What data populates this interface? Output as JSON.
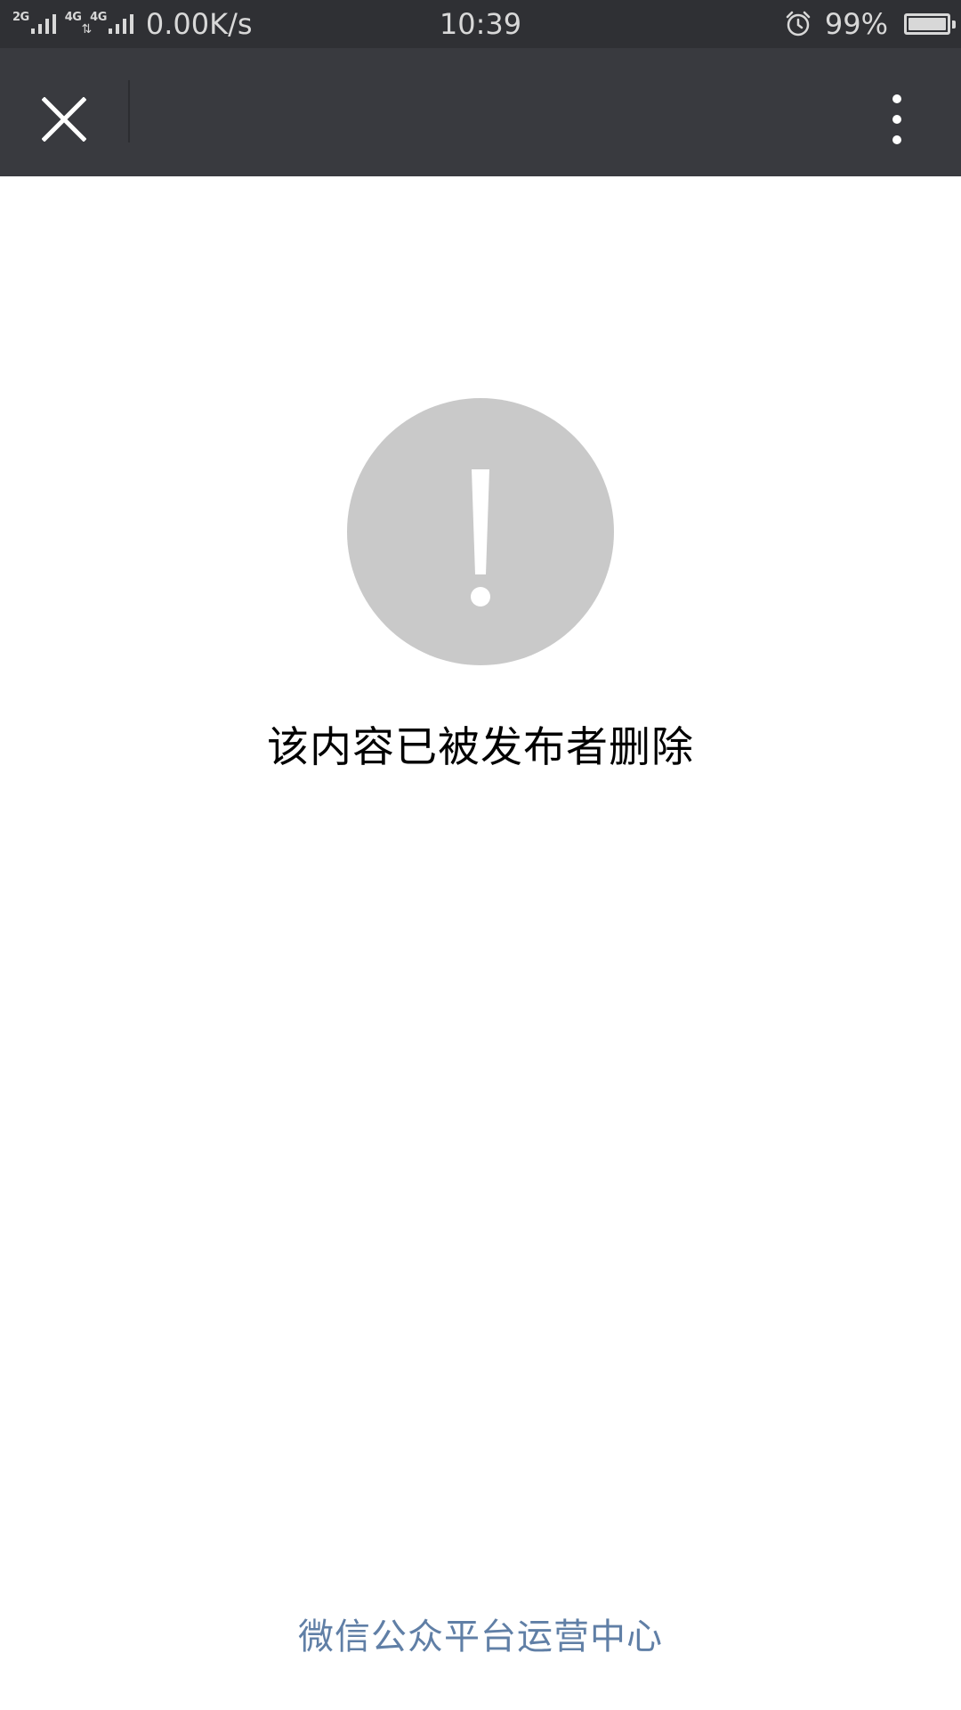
{
  "status_bar": {
    "network_2g": "2G",
    "network_4g_1": "4G",
    "network_4g_2": "4G",
    "net_arrows": "⇅",
    "speed": "0.00K/s",
    "time": "10:39",
    "battery_percent": "99%",
    "battery_level": 0.99,
    "icons": [
      "signal-icon",
      "alarm-icon",
      "battery-icon"
    ]
  },
  "nav_bar": {
    "close_icon": "close-icon",
    "more_icon": "more-vertical-icon"
  },
  "content": {
    "icon": "exclamation-icon",
    "message": "该内容已被发布者删除"
  },
  "footer": {
    "link_text": "微信公众平台运营中心"
  },
  "colors": {
    "status_bar_bg": "#2f3034",
    "nav_bar_bg": "#393a3f",
    "warning_circle": "#c9c9c9",
    "link": "#607fa6",
    "text": "#000000"
  }
}
